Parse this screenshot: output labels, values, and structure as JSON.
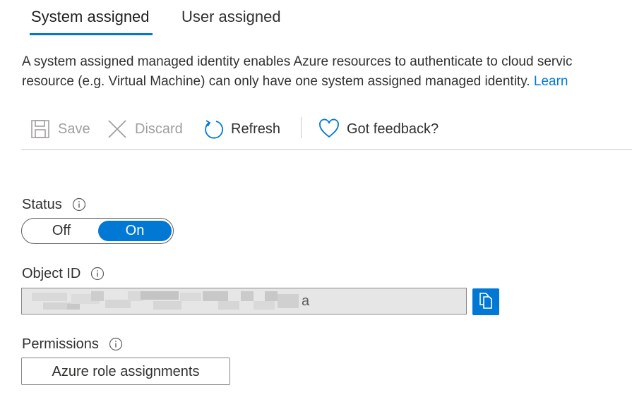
{
  "tabs": {
    "items": [
      {
        "label": "System assigned",
        "active": true
      },
      {
        "label": "User assigned",
        "active": false
      }
    ]
  },
  "description": {
    "line1": "A system assigned managed identity enables Azure resources to authenticate to cloud servic",
    "line2": "resource (e.g. Virtual Machine) can only have one system assigned managed identity.",
    "link": "Learn"
  },
  "toolbar": {
    "save": {
      "label": "Save",
      "icon": "save-icon",
      "enabled": false
    },
    "discard": {
      "label": "Discard",
      "icon": "close-icon",
      "enabled": false
    },
    "refresh": {
      "label": "Refresh",
      "icon": "refresh-icon",
      "enabled": true
    },
    "feedback": {
      "label": "Got feedback?",
      "icon": "heart-icon",
      "enabled": true
    }
  },
  "status": {
    "label": "Status",
    "off_label": "Off",
    "on_label": "On",
    "selected": "On"
  },
  "object_id": {
    "label": "Object ID",
    "value": "a"
  },
  "permissions": {
    "label": "Permissions",
    "button_label": "Azure role assignments"
  },
  "colors": {
    "accent": "#0078d4",
    "text": "#323130",
    "disabled": "#a19f9d"
  }
}
